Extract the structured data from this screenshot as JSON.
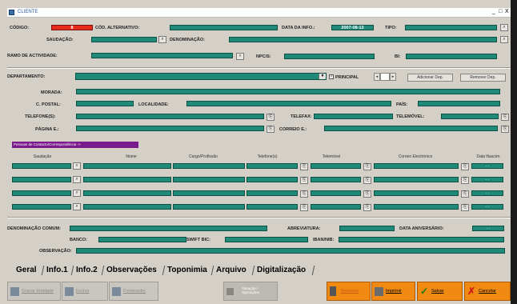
{
  "window": {
    "title": "CLIENTE",
    "controls": [
      "_",
      "□",
      "X"
    ]
  },
  "labels": {
    "codigo": "CÓDIGO:",
    "cod_alt": "CÓD. ALTERNATIVO:",
    "data_info": "DATA DA INFO.:",
    "tipo": "TIPO:",
    "saudacao": "SAUDAÇÃO:",
    "denominacao": "DENOMINAÇÃO:",
    "ramo": "RAMO DE ACTIVIDADE:",
    "npc": "NPC/S:",
    "bi": "BI:",
    "departamento": "DEPARTAMENTO:",
    "principal": "PRINCIPAL",
    "morada": "MORADA:",
    "cpostal": "C. POSTAL:",
    "localidade": "LOCALIDADE:",
    "pais": "PAÍS:",
    "telefones": "TELEFONE(S):",
    "telefax": "TELEFAX:",
    "telemovel": "TELEMÓVEL:",
    "pagina": "PÁGINA E.:",
    "correio": "CORREIO E.:",
    "den_comum": "DENOMINAÇÃO COMUM:",
    "abreviatura": "ABREVIATURA:",
    "data_aniv": "DATA ANIVERSÁRIO:",
    "banco": "BANCO:",
    "swift": "SWIFT BIC:",
    "iban": "IBAN/NIB:",
    "observacao": "OBSERVAÇÃO:"
  },
  "values": {
    "codigo": "8",
    "data_info": "2007-08-13",
    "date_placeholder": "-  -"
  },
  "buttons": {
    "add_dep": "Adicionar Dep.",
    "remove_dep": "Remover Dep."
  },
  "contacts": {
    "banner": "Pessoas de Contacto/Correspondência ->",
    "headers": [
      "Saudação",
      "Nome",
      "Cargo/Profissão",
      "Telefone(s)",
      "Telemóvel",
      "Correio Electrónico",
      "Data Nascim."
    ]
  },
  "tabs": [
    "Geral",
    "Info.1",
    "Info.2",
    "Observações",
    "Toponimia",
    "Arquivo",
    "Digitalização"
  ],
  "bottom": {
    "gravar_entidade": "Gravar Entidade",
    "excluir": "Excluir",
    "fornecedor": "Fornecedor",
    "situacao": "Situação / Operações",
    "remover": "Remover",
    "imprimir": "Imprimir",
    "salvar": "Salvar",
    "cancelar": "Cancelar"
  },
  "colors": {
    "field": "#1f8a78",
    "code": "#e52b1c",
    "banner": "#7a1a8c",
    "action": "#f08a12"
  }
}
